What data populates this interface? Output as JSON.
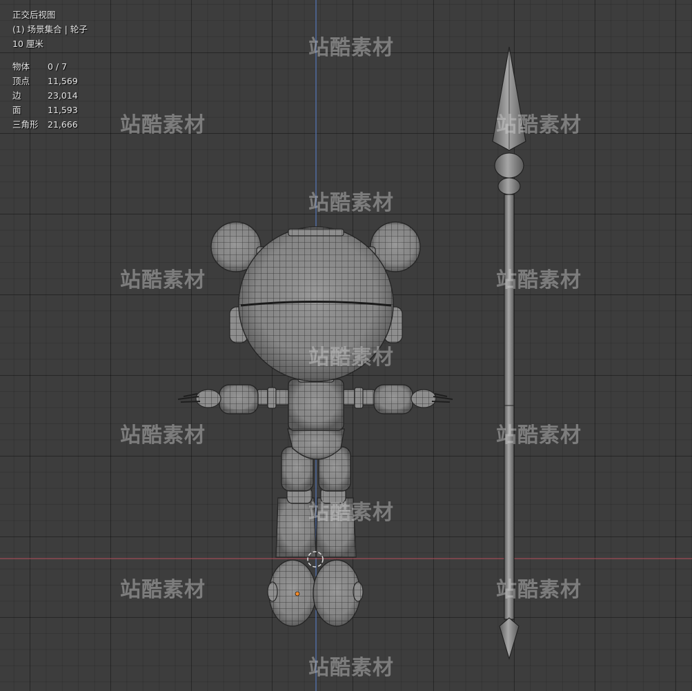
{
  "viewport": {
    "view_name": "正交后视图",
    "collection": "(1) 场景集合 | 轮子",
    "scale": "10 厘米",
    "stats": [
      {
        "label": "物体",
        "value": "0 / 7"
      },
      {
        "label": "顶点",
        "value": "11,569"
      },
      {
        "label": "边",
        "value": "23,014"
      },
      {
        "label": "面",
        "value": "11,593"
      },
      {
        "label": "三角形",
        "value": "21,666"
      }
    ]
  },
  "watermark": {
    "text": "站酷素材"
  },
  "colors": {
    "background": "#3d3d3d",
    "y_axis": "#5577bb",
    "x_axis": "#b84e5a",
    "mesh_fill": "#8f8f8f",
    "wire": "#2e2e2e",
    "origin_dot": "#f08a2a"
  }
}
